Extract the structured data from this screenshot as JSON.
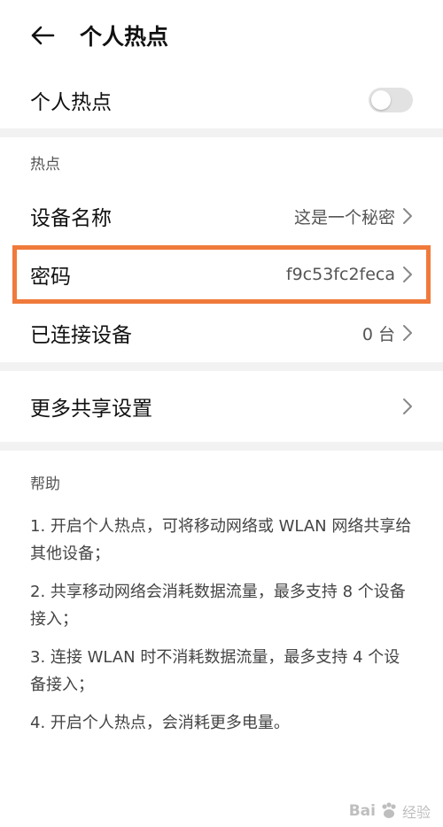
{
  "header": {
    "title": "个人热点"
  },
  "hotspot_toggle": {
    "label": "个人热点",
    "state": "off"
  },
  "section_hotspot": {
    "title": "热点"
  },
  "items": [
    {
      "label": "设备名称",
      "value": "这是一个秘密"
    },
    {
      "label": "密码",
      "value": "f9c53fc2feca"
    },
    {
      "label": "已连接设备",
      "value": "0 台"
    }
  ],
  "more": {
    "label": "更多共享设置"
  },
  "help": {
    "title": "帮助",
    "lines": [
      "1. 开启个人热点，可将移动网络或 WLAN 网络共享给其他设备；",
      "2. 共享移动网络会消耗数据流量，最多支持 8 个设备接入；",
      "3. 连接 WLAN 时不消耗数据流量，最多支持 4 个设备接入；",
      "4. 开启个人热点，会消耗更多电量。"
    ]
  },
  "watermark": {
    "logo": "Bai",
    "text": "经验"
  },
  "colors": {
    "highlight": "#f07a3b",
    "toggle_off": "#e2e2e2",
    "divider": "#f2f2f2"
  }
}
